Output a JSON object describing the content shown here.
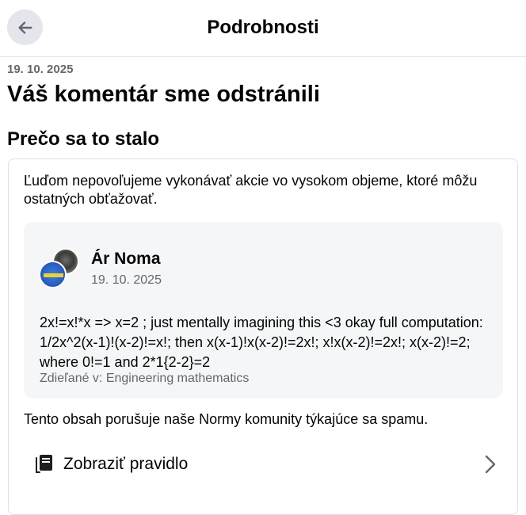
{
  "header": {
    "title": "Podrobnosti",
    "back_icon": "arrow-left-icon"
  },
  "notice": {
    "date": "19. 10. 2025",
    "title": "Váš komentár sme odstránili"
  },
  "reason": {
    "section_title": "Prečo sa to stalo",
    "intro": "Ľuďom nepovoľujeme vykonávať akcie vo vysokom objeme, ktoré môžu ostatných obťažovať.",
    "post": {
      "author": "Ár Noma",
      "date": "19. 10. 2025",
      "body": "2x!=x!*x => x=2 ; just mentally imagining this <3 okay full computation: 1/2x^2(x-1)!(x-2)!=x!; then x(x-1)!x(x-2)!=2x!; x!x(x-2)!=2x!; x(x-2)!=2; where 0!=1 and 2*1{2-2}=2",
      "shared_in": "Zdieľané v: Engineering mathematics"
    },
    "policy_text": "Tento obsah porušuje naše Normy komunity týkajúce sa spamu.",
    "rule_link": {
      "label": "Zobraziť pravidlo",
      "icon": "book-icon",
      "chevron": "chevron-right-icon"
    }
  }
}
